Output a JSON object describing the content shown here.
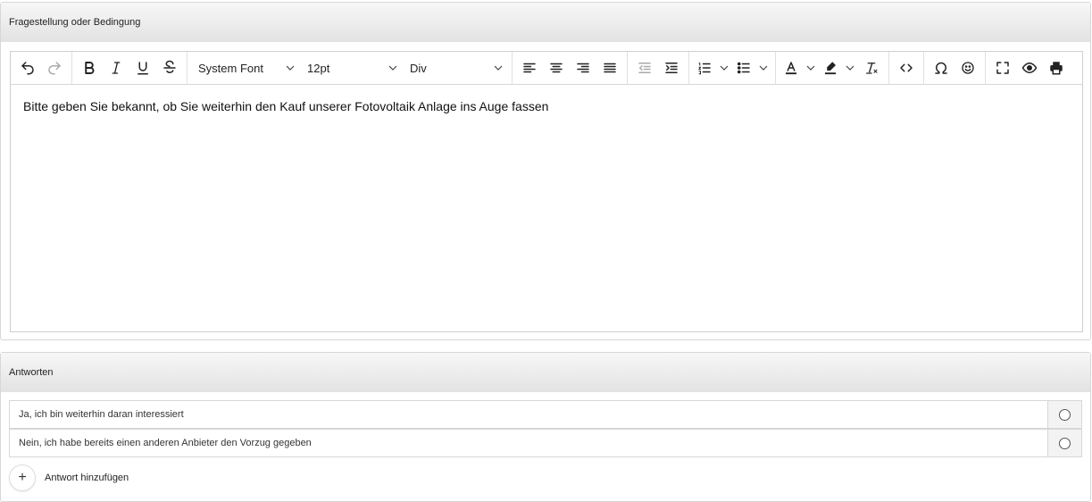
{
  "question_panel": {
    "title": "Fragestellung oder Bedingung"
  },
  "editor": {
    "font_family": "System Font",
    "font_size": "12pt",
    "block_format": "Div",
    "content": "Bitte geben Sie bekannt, ob Sie weiterhin den Kauf unserer Fotovoltaik Anlage ins Auge fassen",
    "toolbar_icons": [
      "undo-icon",
      "redo-icon",
      "bold-icon",
      "italic-icon",
      "underline-icon",
      "strikethrough-icon",
      "align-left-icon",
      "align-center-icon",
      "align-right-icon",
      "align-justify-icon",
      "outdent-icon",
      "indent-icon",
      "numbered-list-icon",
      "bullet-list-icon",
      "text-color-icon",
      "highlight-icon",
      "clear-format-icon",
      "source-code-icon",
      "special-char-icon",
      "emoji-icon",
      "fullscreen-icon",
      "preview-icon",
      "print-icon"
    ]
  },
  "answers_panel": {
    "title": "Antworten",
    "items": [
      {
        "text": "Ja, ich bin weiterhin daran interessiert"
      },
      {
        "text": "Nein, ich habe bereits einen anderen Anbieter den Vorzug gegeben"
      }
    ],
    "add_icon": "+",
    "add_label": "Antwort hinzufügen"
  }
}
